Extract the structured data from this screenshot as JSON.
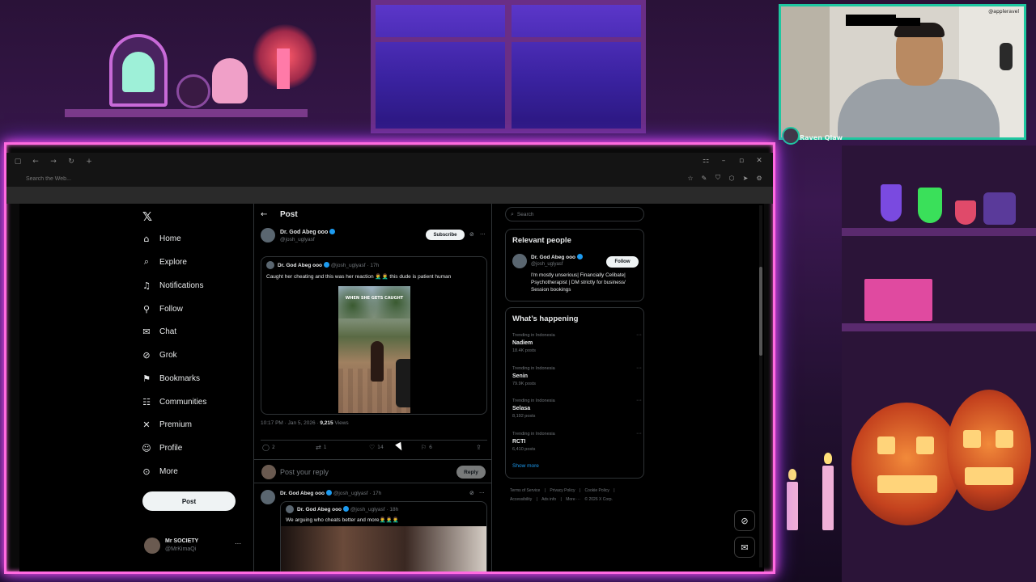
{
  "webcam": {
    "handle": "@appleravel",
    "name": "Raven Qlaw"
  },
  "browser": {
    "address_placeholder": "Search the Web..."
  },
  "nav": {
    "items": [
      {
        "label": "Home",
        "icon": "home-icon"
      },
      {
        "label": "Explore",
        "icon": "search-icon"
      },
      {
        "label": "Notifications",
        "icon": "bell-icon"
      },
      {
        "label": "Follow",
        "icon": "add-user-icon"
      },
      {
        "label": "Chat",
        "icon": "mail-icon"
      },
      {
        "label": "Grok",
        "icon": "grok-icon"
      },
      {
        "label": "Bookmarks",
        "icon": "bookmark-icon"
      },
      {
        "label": "Communities",
        "icon": "people-icon"
      },
      {
        "label": "Premium",
        "icon": "x-logo-icon"
      },
      {
        "label": "Profile",
        "icon": "profile-icon"
      },
      {
        "label": "More",
        "icon": "more-circle-icon"
      }
    ],
    "post_label": "Post",
    "account": {
      "name": "Mr SOCIETY",
      "handle": "@MrKimaQi"
    }
  },
  "post": {
    "header_title": "Post",
    "author_name": "Dr. God Abeg ooo",
    "author_handle": "@josh_uglyasf",
    "subscribe_label": "Subscribe",
    "quote": {
      "name": "Dr. God Abeg ooo",
      "handle": "@josh_uglyasf",
      "time": "17h",
      "text": "Caught her cheating and this was her reaction 🤦‍♂️🤦‍♂️ this dude is patient human",
      "video_caption": "WHEN SHE GETS CAUGHT"
    },
    "meta_time": "10:17 PM · Jan 5, 2026 · ",
    "meta_views_count": "9,215",
    "meta_views_label": " Views",
    "stats": {
      "replies": "2",
      "reposts": "1",
      "likes": "14",
      "bookmarks": "6"
    },
    "reply_placeholder": "Post your reply",
    "reply_button": "Reply"
  },
  "reply": {
    "name": "Dr. God Abeg ooo",
    "handle": "@josh_uglyasf",
    "time": "17h",
    "quote_name": "Dr. God Abeg ooo",
    "quote_handle": "@josh_uglyasf",
    "quote_time": "18h",
    "quote_text": "We arguing who cheats better and more🤦‍♂️🤦‍♂️🤦‍♂️"
  },
  "sidebar": {
    "search_placeholder": "Search",
    "relevant_title": "Relevant people",
    "relevant": {
      "name": "Dr. God Abeg ooo",
      "handle": "@josh_uglyasf",
      "follow_label": "Follow",
      "bio": "I'm mostly unserious| Financially Celibate| Psychotherapist | DM strictly for business/ Session bookings"
    },
    "happening_title": "What’s happening",
    "trends": [
      {
        "context": "Trending in Indonesia",
        "name": "Nadiem",
        "count": "18.4K posts"
      },
      {
        "context": "Trending in Indonesia",
        "name": "Senin",
        "count": "79.9K posts"
      },
      {
        "context": "Trending in Indonesia",
        "name": "Selasa",
        "count": "8,192 posts"
      },
      {
        "context": "Trending in Indonesia",
        "name": "RCTI",
        "count": "6,410 posts"
      }
    ],
    "show_more": "Show more",
    "footer": [
      "Terms of Service",
      "|",
      "Privacy Policy",
      "|",
      "Cookie Policy",
      "|",
      "Accessibility",
      "|",
      "Ads info",
      "|",
      "More ···",
      "© 2026 X Corp."
    ]
  },
  "colors": {
    "accent": "#1d9bf0",
    "neon": "#ff6ae0",
    "cam_border": "#1ec7a0"
  }
}
